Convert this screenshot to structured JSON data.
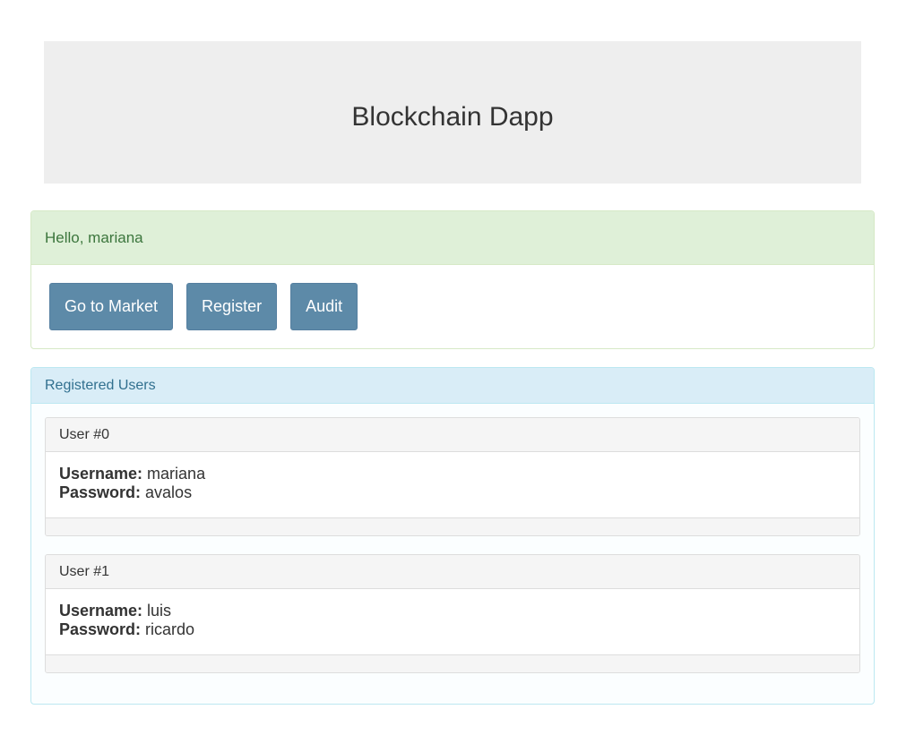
{
  "header": {
    "title": "Blockchain Dapp"
  },
  "greeting_panel": {
    "greeting": "Hello, mariana",
    "buttons": {
      "market": "Go to Market",
      "register": "Register",
      "audit": "Audit"
    }
  },
  "users_panel": {
    "title": "Registered Users",
    "username_label": "Username:",
    "password_label": "Password:",
    "users": [
      {
        "heading": "User #0",
        "username": "mariana",
        "password": "avalos"
      },
      {
        "heading": "User #1",
        "username": "luis",
        "password": "ricardo"
      }
    ]
  },
  "colors": {
    "button_bg": "#5d8aa8",
    "success_bg": "#dff0d8",
    "success_text": "#3c763d",
    "info_bg": "#d9edf7",
    "info_text": "#31708f",
    "jumbotron_bg": "#eeeeee"
  }
}
